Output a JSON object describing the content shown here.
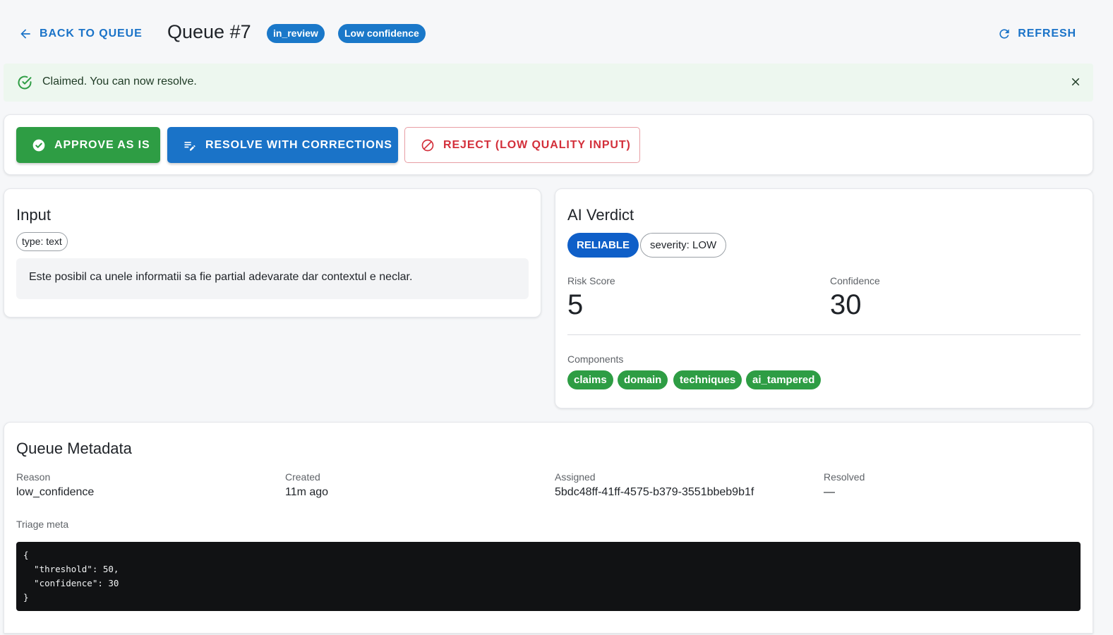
{
  "header": {
    "back_label": "BACK TO QUEUE",
    "title": "Queue #7",
    "status_pill": "in_review",
    "confidence_pill": "Low confidence",
    "refresh_label": "REFRESH"
  },
  "alert": {
    "message": "Claimed. You can now resolve.",
    "type": "success"
  },
  "actions": {
    "approve_label": "APPROVE AS IS",
    "resolve_label": "RESOLVE WITH CORRECTIONS",
    "reject_label": "REJECT (LOW QUALITY INPUT)"
  },
  "input": {
    "title": "Input",
    "type_chip": "type: text",
    "text": "Este posibil ca unele informatii sa fie partial adevarate dar contextul e neclar."
  },
  "verdict": {
    "title": "AI Verdict",
    "label": "RELIABLE",
    "severity": "severity: LOW",
    "risk_label": "Risk Score",
    "risk_value": "5",
    "confidence_label": "Confidence",
    "confidence_value": "30",
    "components_label": "Components",
    "components": [
      "claims",
      "domain",
      "techniques",
      "ai_tampered"
    ]
  },
  "metadata": {
    "title": "Queue Metadata",
    "fields": [
      {
        "label": "Reason",
        "value": "low_confidence"
      },
      {
        "label": "Created",
        "value": "11m ago"
      },
      {
        "label": "Assigned",
        "value": "5bdc48ff-41ff-4575-b379-3551bbeb9b1f"
      },
      {
        "label": "Resolved",
        "value": "—"
      }
    ],
    "triage_label": "Triage meta",
    "triage_json": "{\n  \"threshold\": 50,\n  \"confidence\": 30\n}"
  },
  "colors": {
    "primary": "#1a73c8",
    "success": "#2e9d44",
    "danger": "#d32f3a",
    "verdict_badge": "#0f5fc8",
    "alert_bg": "#edf7ef"
  }
}
